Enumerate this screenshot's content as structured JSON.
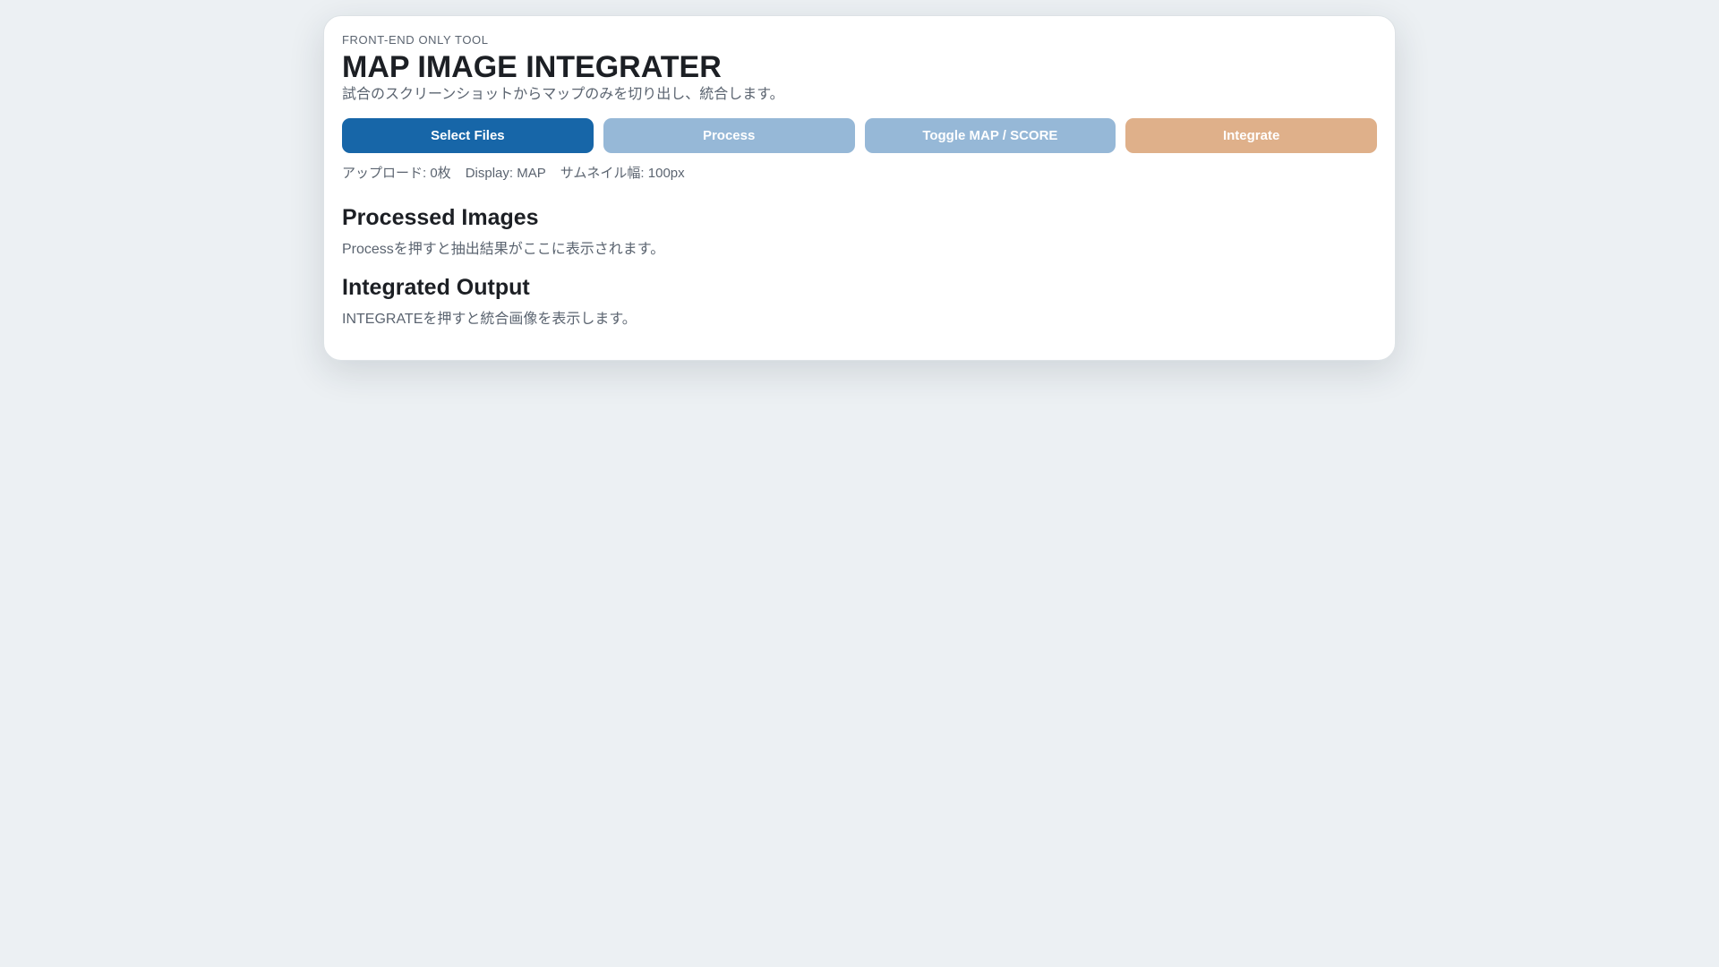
{
  "header": {
    "eyebrow": "FRONT-END ONLY TOOL",
    "title": "MAP IMAGE INTEGRATER",
    "subtitle": "試合のスクリーンショットからマップのみを切り出し、統合します。"
  },
  "toolbar": {
    "select_files": "Select Files",
    "process": "Process",
    "toggle": "Toggle MAP / SCORE",
    "integrate": "Integrate"
  },
  "status": {
    "upload": "アップロード: 0枚",
    "display": "Display: MAP",
    "thumb_width": "サムネイル幅: 100px"
  },
  "processed": {
    "heading": "Processed Images",
    "placeholder": "Processを押すと抽出結果がここに表示されます。"
  },
  "integrated": {
    "heading": "Integrated Output",
    "placeholder": "INTEGRATEを押すと統合画像を表示します。"
  },
  "colors": {
    "primary": "#1766a8",
    "muted": "#96b8d7",
    "warm": "#dfb08a",
    "background": "#ecf0f3"
  }
}
